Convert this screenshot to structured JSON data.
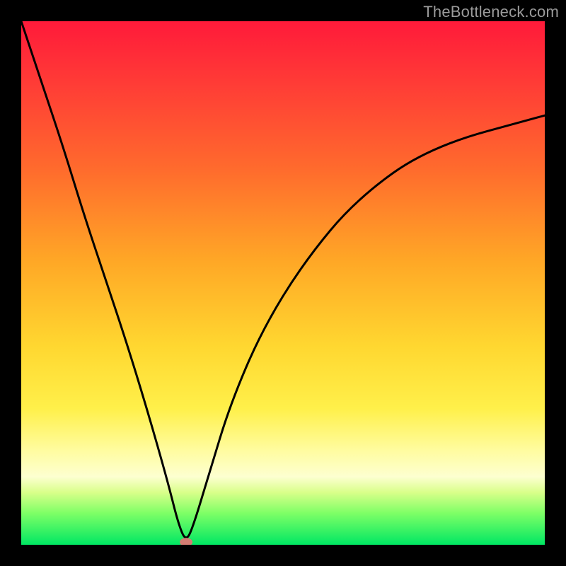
{
  "watermark": "TheBottleneck.com",
  "chart_data": {
    "type": "line",
    "title": "",
    "xlabel": "",
    "ylabel": "",
    "xlim": [
      0,
      100
    ],
    "ylim": [
      0,
      100
    ],
    "grid": false,
    "legend": false,
    "series": [
      {
        "name": "bottleneck-curve",
        "x": [
          0,
          4,
          8,
          12,
          16,
          20,
          24,
          28,
          30,
          31.5,
          33,
          36,
          40,
          46,
          54,
          64,
          78,
          100
        ],
        "y": [
          100,
          88,
          76,
          63,
          51,
          39,
          26,
          12,
          4,
          0.5,
          4,
          14,
          27,
          41,
          54,
          66,
          76,
          82
        ]
      }
    ],
    "marker": {
      "name": "optimal-point",
      "x": 31.5,
      "y": 0.5,
      "color": "#d47d73",
      "rx": 9,
      "ry": 6
    },
    "colors": {
      "curve": "#000000",
      "background_top": "#ff1a3a",
      "background_bottom": "#00e763",
      "frame": "#000000"
    }
  }
}
